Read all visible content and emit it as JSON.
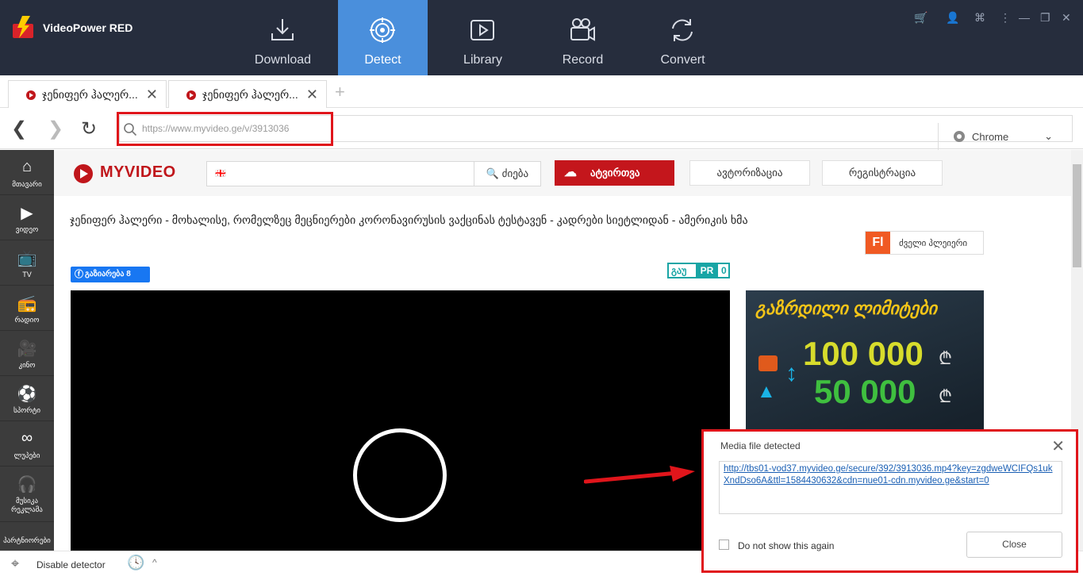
{
  "app": {
    "title": "VideoPower RED",
    "nav": [
      {
        "label": "Download",
        "icon": "download-icon"
      },
      {
        "label": "Detect",
        "icon": "detect-icon",
        "active": true
      },
      {
        "label": "Library",
        "icon": "library-icon"
      },
      {
        "label": "Record",
        "icon": "record-icon"
      },
      {
        "label": "Convert",
        "icon": "convert-icon"
      }
    ],
    "accent": "#4a8fdc"
  },
  "tabs": [
    {
      "label": "ჯენიფერ ჰალერ..."
    },
    {
      "label": "ჯენიფერ ჰალერ..."
    }
  ],
  "address": {
    "url": "https://www.myvideo.ge/v/3913036",
    "browser": "Chrome"
  },
  "sidebar": [
    {
      "label": "მთავარი",
      "icon": "home-icon"
    },
    {
      "label": "ვიდეო",
      "icon": "play-icon"
    },
    {
      "label": "TV",
      "icon": "tv-icon"
    },
    {
      "label": "რადიო",
      "icon": "radio-icon"
    },
    {
      "label": "კინო",
      "icon": "camera-icon"
    },
    {
      "label": "სპორტი",
      "icon": "ball-icon"
    },
    {
      "label": "ლუპები",
      "icon": "loop-icon"
    },
    {
      "label": "მუსიკა რეკლამა",
      "icon": "headphones-icon"
    },
    {
      "label": "პარტნიორები",
      "icon": "partners-icon"
    }
  ],
  "site": {
    "logo": "MYVIDEO",
    "search_button": "ძიება",
    "upload": "ატვირთვა",
    "login": "ავტორიზაცია",
    "register": "რეგისტრაცია",
    "video_title": "ჯენიფერ ჰალერი - მოხალისე, რომელზეც მეცნიერები კორონავირუსის ვაქცინას ტესტავენ - კადრები სიეტლიდან - ამერიკის ხმა",
    "old_player": "ძველი პლეიერი",
    "old_player_badge": "Fl",
    "share": "გაზიარება 8",
    "gaupro": [
      "გაუ",
      "PR",
      "0"
    ],
    "ad": {
      "headline": "გაზრდილი ლიმიტები",
      "amount_1": "100 000",
      "amount_2": "50 000",
      "currency": "₾"
    }
  },
  "status": {
    "detector": "Disable detector"
  },
  "dialog": {
    "title": "Media file detected",
    "url": "http://tbs01-vod37.myvideo.ge/secure/392/3913036.mp4?key=zgdweWCIFQs1ukXndDso6A&ttl=1584430632&cdn=nue01-cdn.myvideo.ge&start=0",
    "checkbox": "Do not show this again",
    "close": "Close"
  }
}
